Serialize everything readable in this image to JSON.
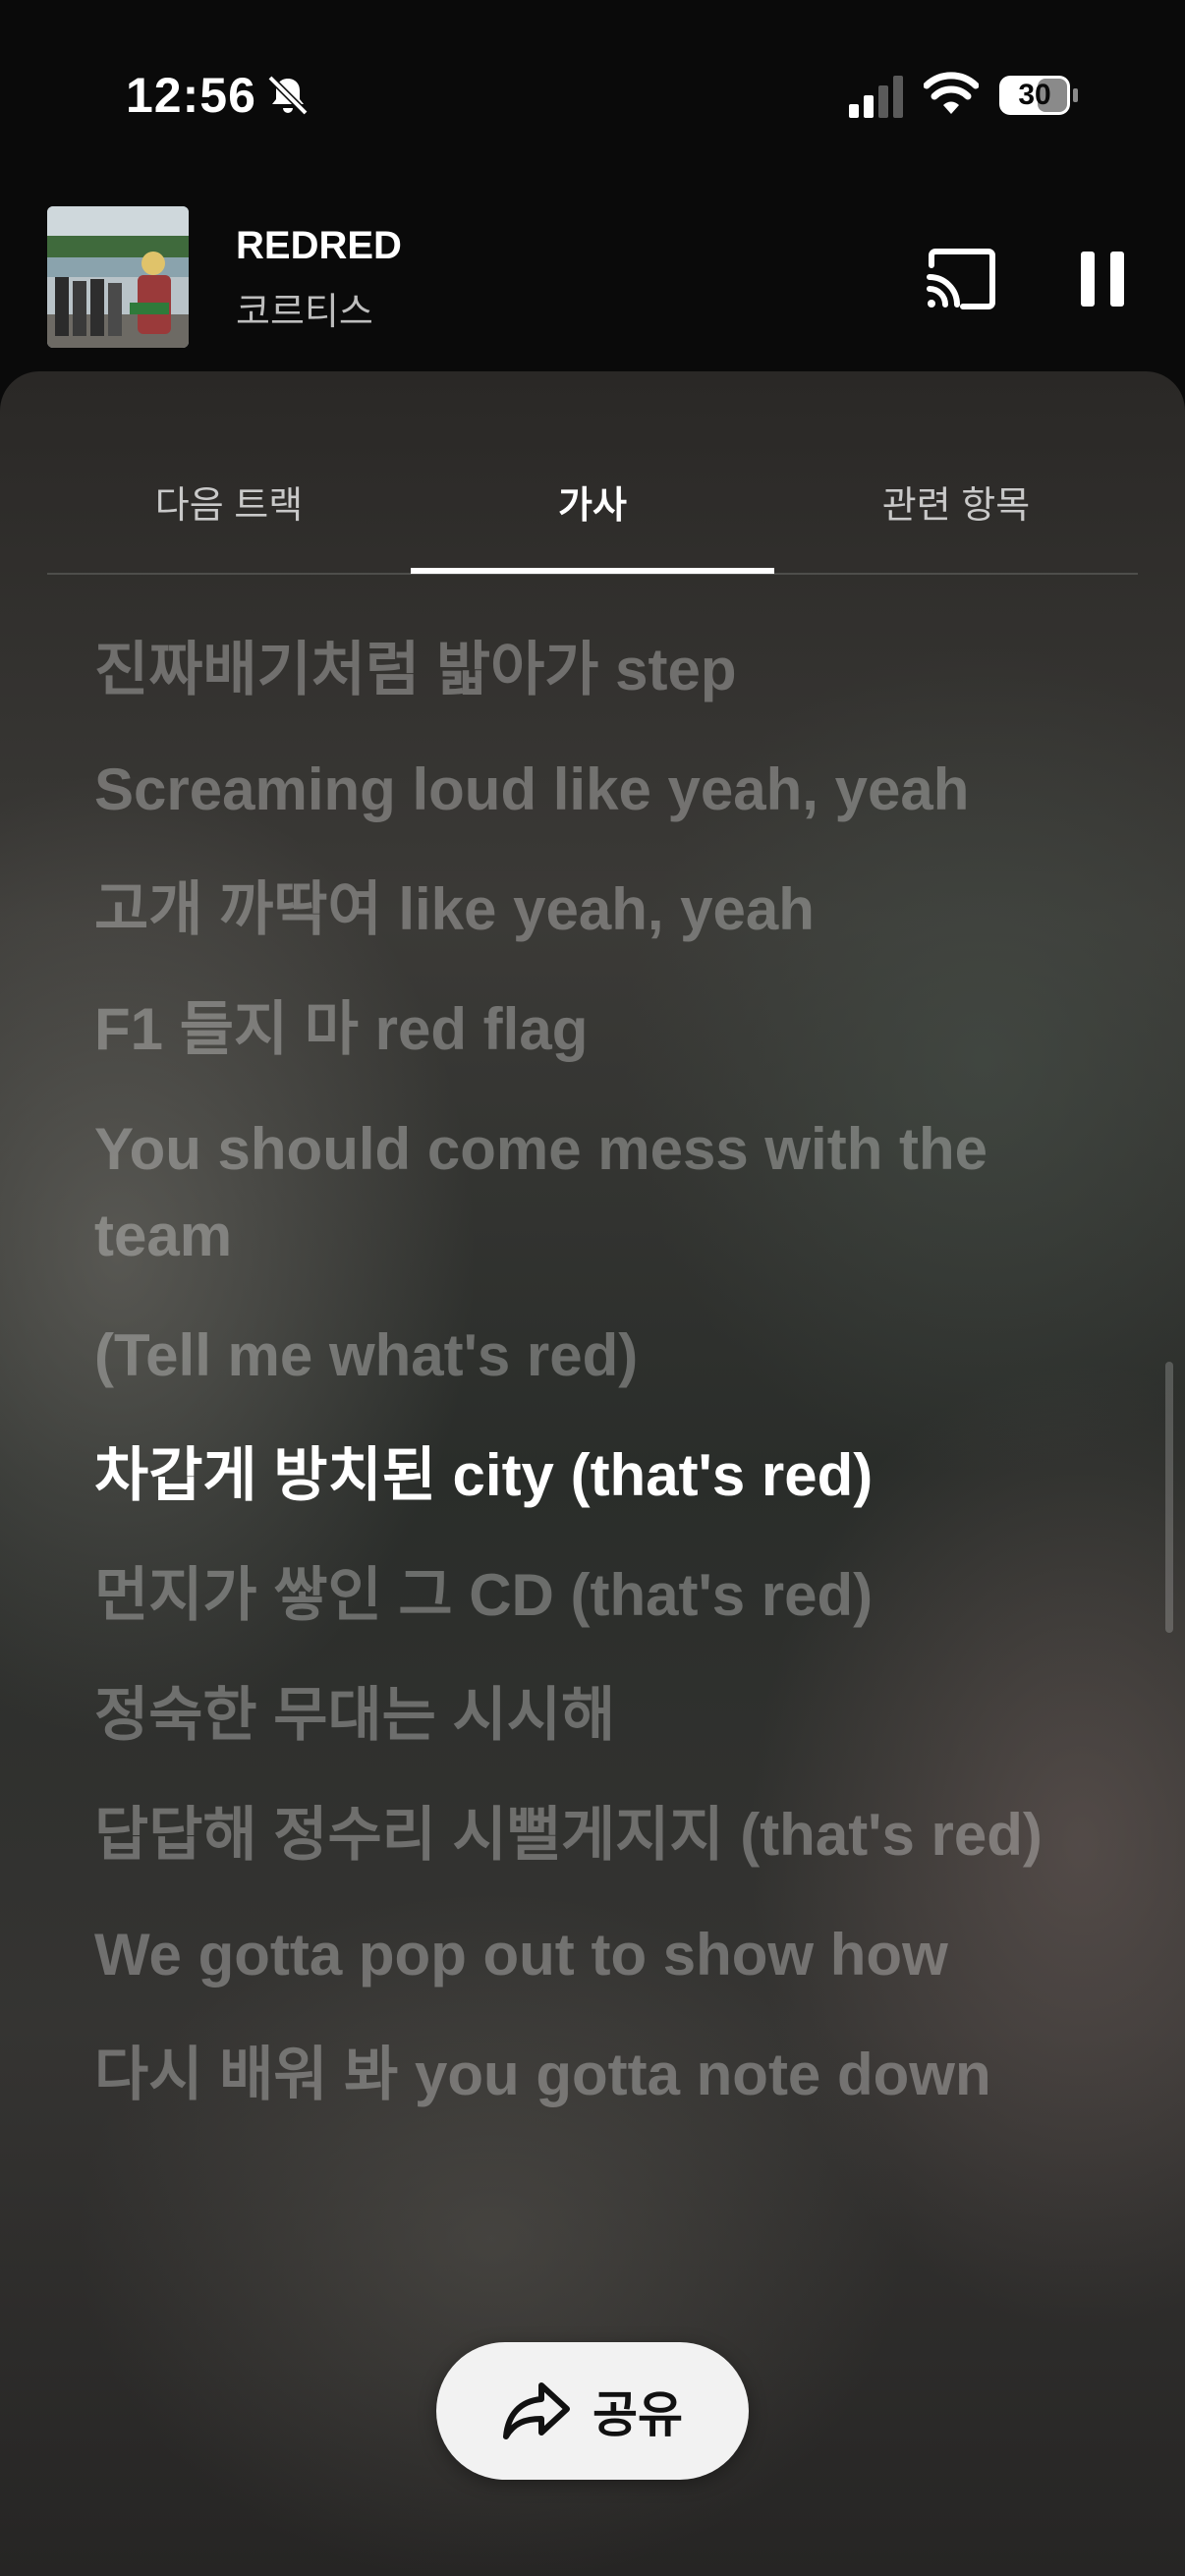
{
  "status_bar": {
    "time": "12:56",
    "battery": "30"
  },
  "now_playing": {
    "title": "REDRED",
    "artist": "코르티스"
  },
  "tabs": [
    {
      "label": "다음 트랙"
    },
    {
      "label": "가사"
    },
    {
      "label": "관련 항목"
    }
  ],
  "active_tab": "가사",
  "lyrics": [
    "진짜배기처럼 밟아가 step",
    "Screaming loud like yeah, yeah",
    "고개 까딱여 like yeah, yeah",
    "F1 들지 마 red flag",
    "You should come mess with the team",
    "(Tell me what's red)",
    "차갑게 방치된 city (that's red)",
    "먼지가 쌓인 그 CD (that's red)",
    "정숙한 무대는 시시해",
    "답답해 정수리 시뻘게지지 (that's red)",
    "We gotta pop out to show how",
    "다시 배워 봐 you gotta note down"
  ],
  "current_lyric": "차갑게 방치된 city (that's red)",
  "share_label": "공유",
  "colors": {
    "background": "#0a0a0a",
    "current_lyric": "#ffffff",
    "share_button": "#f2f2f2"
  },
  "icons": [
    "bell-slash-icon",
    "cellular-signal-icon",
    "wifi-icon",
    "battery-icon",
    "cast-icon",
    "pause-icon",
    "share-icon"
  ]
}
